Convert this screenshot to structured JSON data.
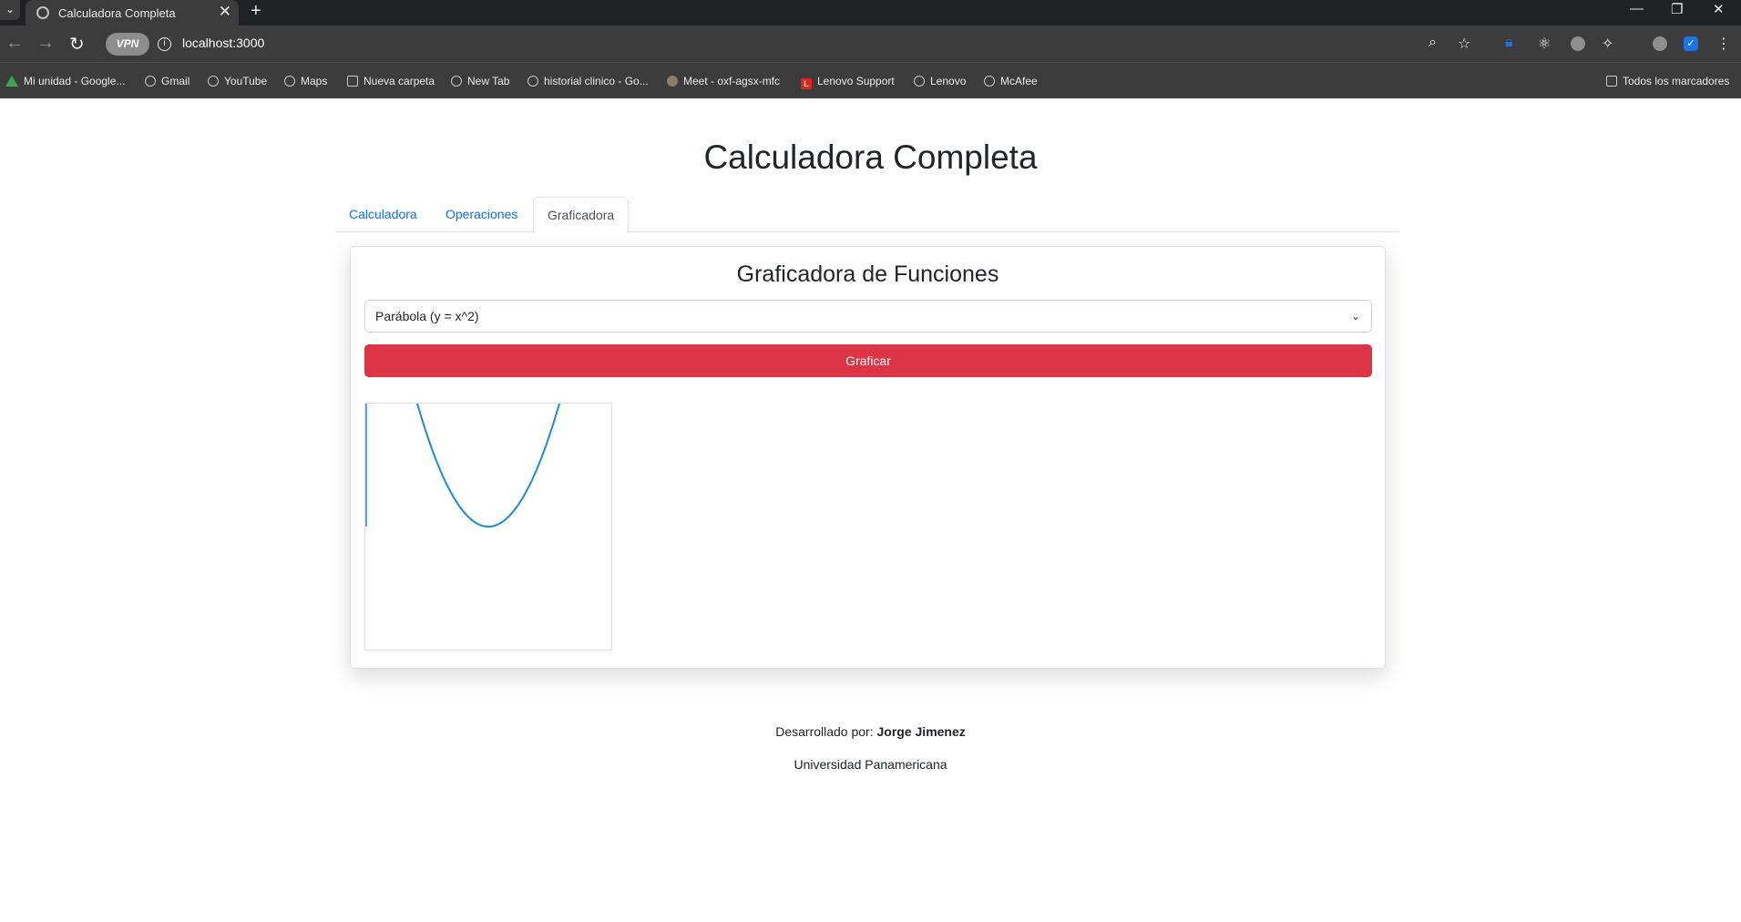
{
  "browser": {
    "tab_title": "Calculadora Completa",
    "url": "localhost:3000",
    "vpn_label": "VPN",
    "new_tab_symbol": "+",
    "close_symbol": "✕",
    "bookmarks": [
      {
        "label": "Mi unidad - Google...",
        "icon": "drive-icon"
      },
      {
        "label": "Gmail",
        "icon": "globe-icon"
      },
      {
        "label": "YouTube",
        "icon": "globe-icon"
      },
      {
        "label": "Maps",
        "icon": "globe-icon"
      },
      {
        "label": "Nueva carpeta",
        "icon": "folder-icon"
      },
      {
        "label": "New Tab",
        "icon": "globe-icon"
      },
      {
        "label": "historial clinico - Go...",
        "icon": "globe-icon"
      },
      {
        "label": "Meet - oxf-agsx-mfc",
        "icon": "meet-icon"
      },
      {
        "label": "Lenovo Support",
        "icon": "lenovo-icon"
      },
      {
        "label": "Lenovo",
        "icon": "globe-icon"
      },
      {
        "label": "McAfee",
        "icon": "globe-icon"
      }
    ],
    "all_bookmarks": "Todos los marcadores"
  },
  "page": {
    "title": "Calculadora Completa",
    "tabs": [
      {
        "label": "Calculadora",
        "active": false
      },
      {
        "label": "Operaciones",
        "active": false
      },
      {
        "label": "Graficadora",
        "active": true
      }
    ],
    "card": {
      "title": "Graficadora de Funciones",
      "select_value": "Parábola (y = x^2)",
      "button_label": "Graficar"
    },
    "footer": {
      "developed_by_label": "Desarrollado por:",
      "developer": "Jorge Jimenez",
      "university": "Universidad Panamericana"
    }
  },
  "plot": {
    "function": "y = x^2",
    "line_color": "#1e88e5",
    "button_color": "#dc3545"
  }
}
